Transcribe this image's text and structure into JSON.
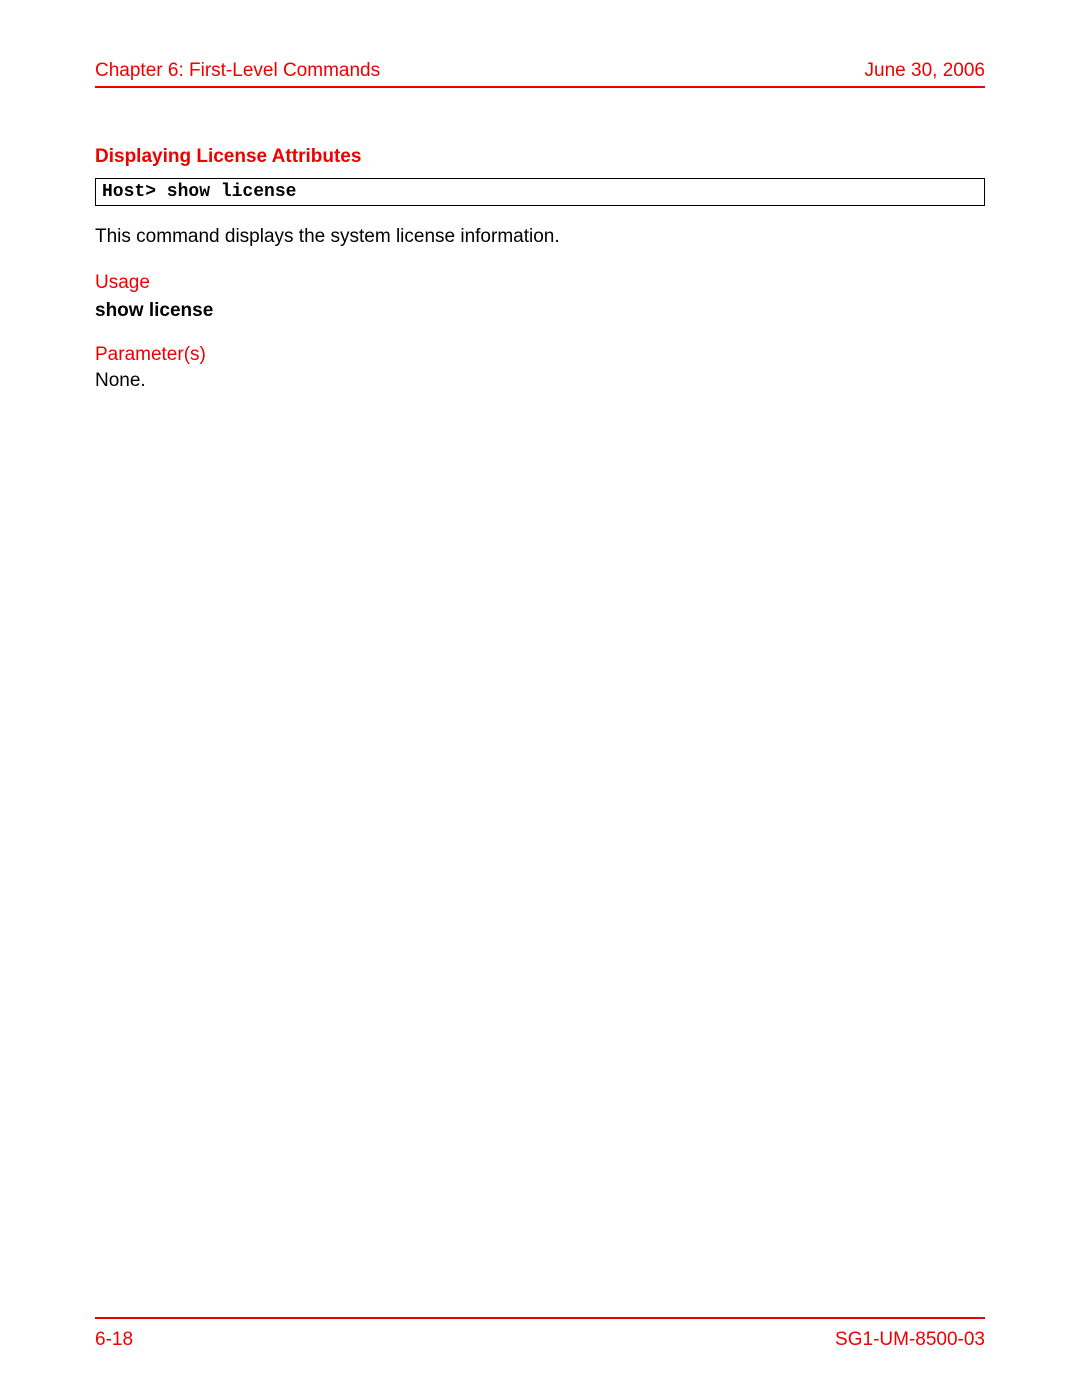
{
  "header": {
    "chapter": "Chapter 6: First-Level Commands",
    "date": "June 30, 2006"
  },
  "section": {
    "title": "Displaying License Attributes",
    "command_box": "Host> show license",
    "description": "This command displays the system license information.",
    "usage_label": "Usage",
    "usage_command": "show license",
    "parameters_label": "Parameter(s)",
    "parameters_value": "None."
  },
  "footer": {
    "page_number": "6-18",
    "doc_id": "SG1-UM-8500-03"
  }
}
